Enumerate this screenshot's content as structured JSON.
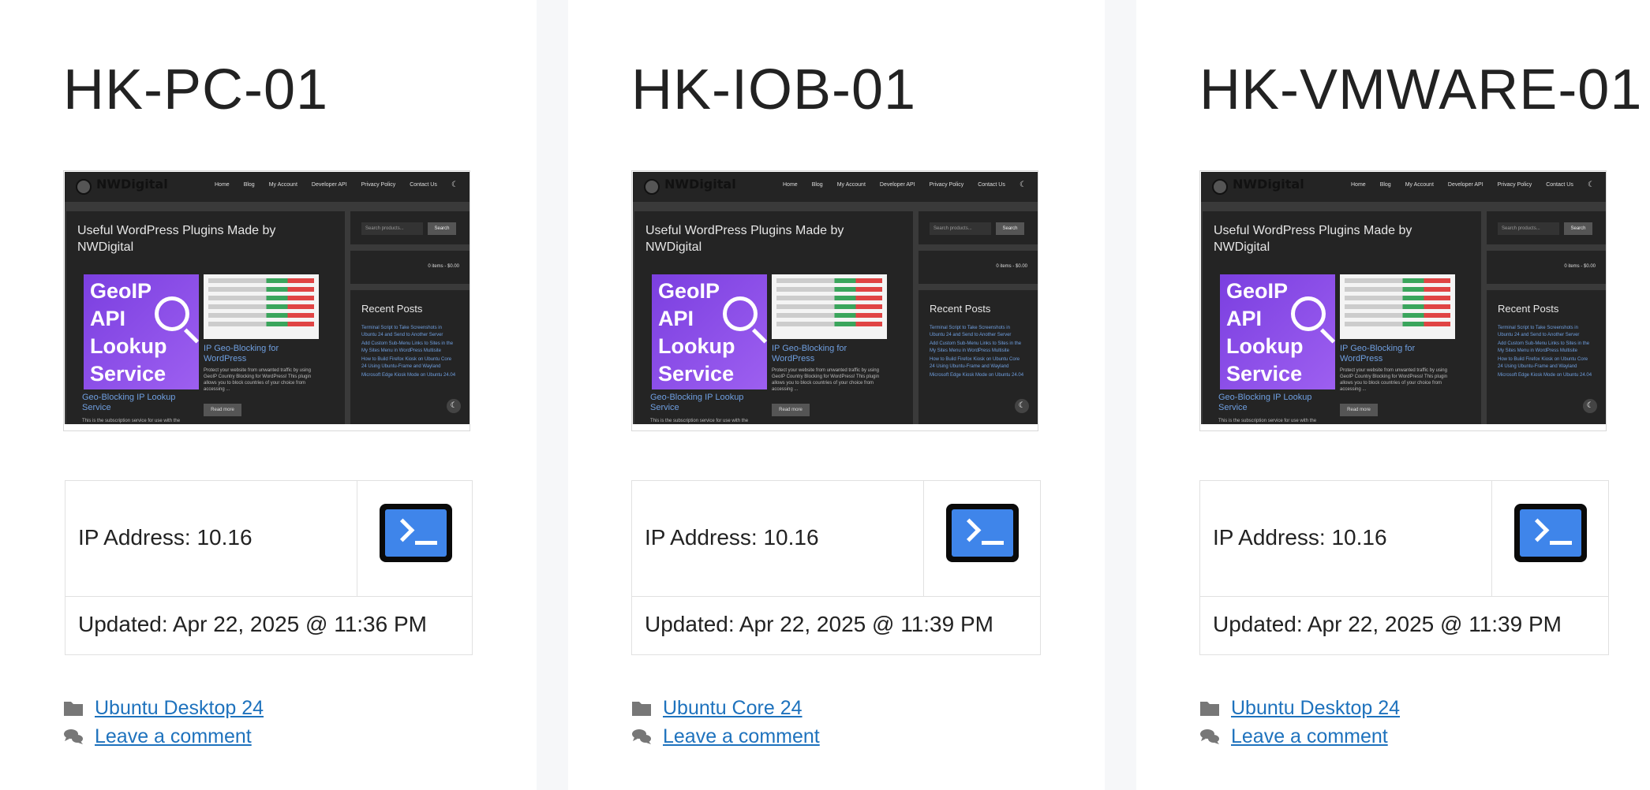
{
  "cards": [
    {
      "title": "HK-PC-01",
      "ip_label": "IP Address: 10.16",
      "updated": "Updated: Apr 22, 2025 @ 11:36 PM",
      "category": "Ubuntu Desktop 24",
      "comment": "Leave a comment"
    },
    {
      "title": "HK-IOB-01",
      "ip_label": "IP Address: 10.16",
      "updated": "Updated: Apr 22, 2025 @ 11:39 PM",
      "category": "Ubuntu Core 24",
      "comment": "Leave a comment"
    },
    {
      "title": "HK-VMWARE-01",
      "ip_label": "IP Address: 10.16",
      "updated": "Updated: Apr 22, 2025 @ 11:39 PM",
      "category": "Ubuntu Desktop 24",
      "comment": "Leave a comment"
    }
  ],
  "screenshot": {
    "brand": "NWDigital",
    "nav": [
      "Home",
      "Blog",
      "My Account",
      "Developer API",
      "Privacy Policy",
      "Contact Us"
    ],
    "heading": "Useful WordPress Plugins Made by NWDigital",
    "geoip_lines": [
      "GeoIP",
      "API",
      "Lookup",
      "Service"
    ],
    "product_link_1": "IP Geo-Blocking for WordPress",
    "product_desc_1": "Protect your website from unwanted traffic by using GeoIP Country Blocking for WordPress! This plugin allows you to block countries of your choice from accessing ...",
    "product_link_2": "Geo-Blocking IP Lookup Service",
    "product_desc_2": "This is the subscription service for use with the",
    "read_more": "Read more",
    "search_placeholder": "Search products...",
    "search_button": "Search",
    "cart": "0 items - $0.00",
    "recent_posts_title": "Recent Posts",
    "recent_posts": [
      "Terminal Script to Take Screenshots in Ubuntu 24 and Send to Another Server",
      "Add Custom Sub-Menu Links to Sites in the My Sites Menu in WordPress Multisite",
      "How to Build Firefox Kiosk on Ubuntu Core 24 Using Ubuntu-Frame and Wayland",
      "Microsoft Edge Kiosk Mode on Ubuntu 24.04"
    ]
  },
  "icons": {
    "category": "folder-icon",
    "comment": "comments-icon",
    "terminal": "terminal-icon",
    "terminal_color": "#3f85ea",
    "link_color": "#1e72bd"
  }
}
